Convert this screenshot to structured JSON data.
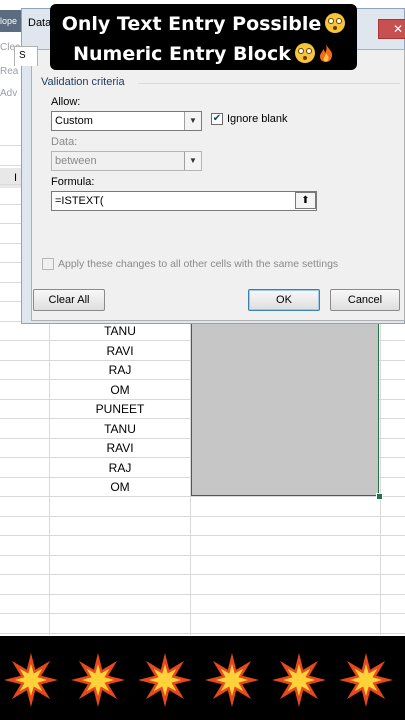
{
  "background": {
    "developer_tab_fragment": "lope",
    "ribbon_fragments": [
      "Clea",
      "Rea",
      "Adv"
    ],
    "column_header_fragment": "I",
    "names": [
      "TANU",
      "RAVI",
      "RAJ",
      "OM",
      "PUNEET",
      "TANU",
      "RAVI",
      "RAJ",
      "OM"
    ],
    "selection_color": "#c6c6c6",
    "selection_border_color": "#217346"
  },
  "banner": {
    "line1": "Only Text Entry Possible",
    "line2": "Numeric Entry Block",
    "line1_emoji": "flushed-face-icon",
    "line2_emojis": [
      "flushed-face-icon",
      "fire-icon"
    ]
  },
  "dialog": {
    "title_fragment": "Data",
    "close_label": "✕",
    "tab_fragment": "S",
    "group_label": "Validation criteria",
    "allow_label": "Allow:",
    "allow_value": "Custom",
    "ignore_blank_label": "Ignore blank",
    "ignore_blank_checked": true,
    "data_label": "Data:",
    "data_value": "between",
    "formula_label": "Formula:",
    "formula_value": "=ISTEXT(",
    "apply_all_label": "Apply these changes to all other cells with the same settings",
    "apply_all_checked": false,
    "clear_all_label": "Clear All",
    "ok_label": "OK",
    "cancel_label": "Cancel"
  },
  "bottom_strip": {
    "icons": [
      "explosion-icon",
      "explosion-icon",
      "explosion-icon",
      "explosion-icon",
      "explosion-icon",
      "explosion-icon"
    ]
  }
}
